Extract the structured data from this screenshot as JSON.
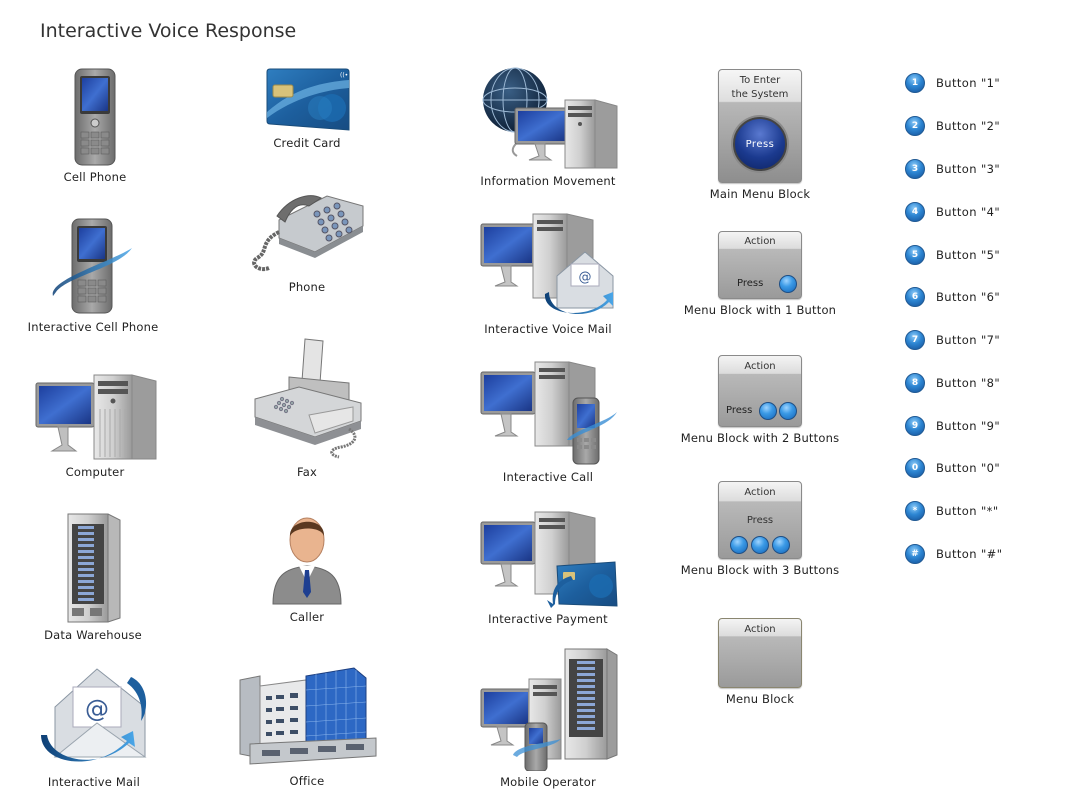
{
  "title": "Interactive Voice Response",
  "shapes": {
    "cell_phone": "Cell Phone",
    "credit_card": "Credit Card",
    "information_movement": "Information Movement",
    "interactive_cell_phone": "Interactive Cell Phone",
    "phone": "Phone",
    "interactive_voice_mail": "Interactive Voice Mail",
    "computer": "Computer",
    "fax": "Fax",
    "interactive_call": "Interactive Call",
    "data_warehouse": "Data Warehouse",
    "caller": "Caller",
    "interactive_payment": "Interactive Payment",
    "interactive_mail": "Interactive Mail",
    "office": "Office",
    "mobile_operator": "Mobile Operator"
  },
  "menu_blocks": {
    "main": {
      "label": "Main Menu Block",
      "title_line1": "To Enter",
      "title_line2": "the System",
      "press": "Press"
    },
    "one": {
      "label": "Menu Block with 1 Button",
      "title": "Action",
      "press": "Press"
    },
    "two": {
      "label": "Menu Block with 2 Buttons",
      "title": "Action",
      "press": "Press"
    },
    "three": {
      "label": "Menu Block with 3 Buttons",
      "title": "Action",
      "press": "Press"
    },
    "plain": {
      "label": "Menu Block",
      "title": "Action"
    }
  },
  "buttons": [
    {
      "glyph": "1",
      "label": "Button \"1\""
    },
    {
      "glyph": "2",
      "label": "Button \"2\""
    },
    {
      "glyph": "3",
      "label": "Button \"3\""
    },
    {
      "glyph": "4",
      "label": "Button \"4\""
    },
    {
      "glyph": "5",
      "label": "Button \"5\""
    },
    {
      "glyph": "6",
      "label": "Button \"6\""
    },
    {
      "glyph": "7",
      "label": "Button \"7\""
    },
    {
      "glyph": "8",
      "label": "Button \"8\""
    },
    {
      "glyph": "9",
      "label": "Button \"9\""
    },
    {
      "glyph": "0",
      "label": "Button \"0\""
    },
    {
      "glyph": "*",
      "label": "Button \"*\""
    },
    {
      "glyph": "#",
      "label": "Button \"#\""
    }
  ]
}
